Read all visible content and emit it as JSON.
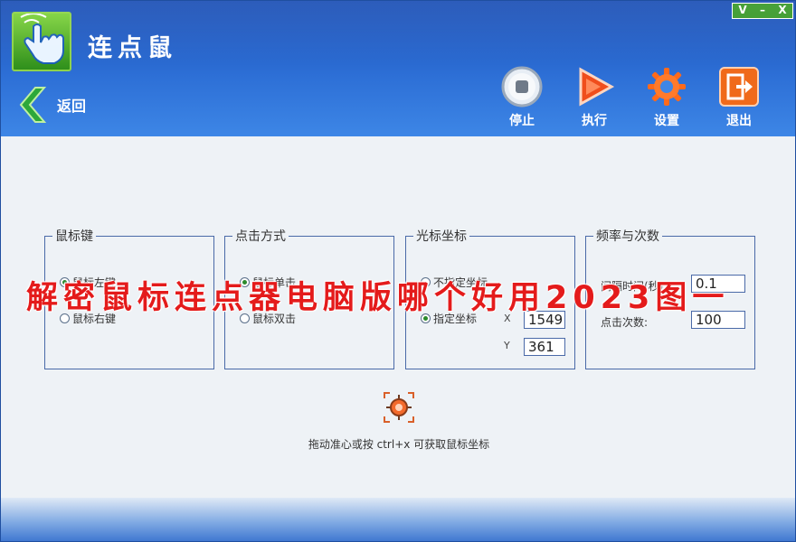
{
  "app": {
    "title": "连点鼠"
  },
  "window_controls": [
    "V",
    "–",
    "X"
  ],
  "nav": {
    "back_label": "返回"
  },
  "toolbar": [
    {
      "label": "停止",
      "icon": "stop-icon"
    },
    {
      "label": "执行",
      "icon": "play-icon"
    },
    {
      "label": "设置",
      "icon": "gear-icon"
    },
    {
      "label": "退出",
      "icon": "exit-icon"
    }
  ],
  "groups": {
    "mouse_button": {
      "title": "鼠标键",
      "options": [
        "鼠标左键",
        "鼠标右键"
      ],
      "selected": 0
    },
    "click_mode": {
      "title": "点击方式",
      "options": [
        "鼠标单击",
        "鼠标双击"
      ],
      "selected": 0
    },
    "cursor_coord": {
      "title": "光标坐标",
      "options": [
        "不指定坐标",
        "指定坐标"
      ],
      "selected": 1,
      "x_label": "X",
      "x_value": "1549",
      "y_label": "Y",
      "y_value": "361"
    },
    "frequency": {
      "title": "频率与次数",
      "interval_label": "间隔时间(秒):",
      "interval_value": "0.1",
      "count_label": "点击次数:",
      "count_value": "100"
    }
  },
  "hint": "拖动准心或按 ctrl+x 可获取鼠标坐标",
  "overlay_text": "解密鼠标连点器电脑版哪个好用2023图一",
  "colors": {
    "header": "#2d6fd6",
    "overlay": "#e41b1b",
    "accent_green": "#3a9a2a"
  }
}
